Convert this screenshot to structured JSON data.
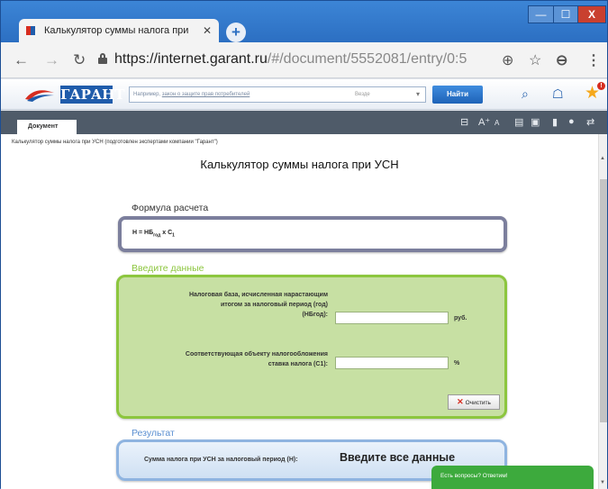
{
  "browser": {
    "tab_title": "Калькулятор суммы налога при",
    "tab_close": "✕",
    "new_tab": "+",
    "url_host": "https://internet.garant.ru",
    "url_path": "/#/document/5552081/entry/0:5",
    "window_controls": {
      "minimize": "—",
      "maximize": "☐",
      "close": "X"
    }
  },
  "garant": {
    "logo": "ГАРАНТ",
    "search_placeholder": "Например,",
    "search_example": "закон о защите прав потребителей",
    "search_scope": "Везде",
    "find_button": "Найти",
    "notification_count": "!"
  },
  "doc_tab": "Документ",
  "document": {
    "breadcrumb": "Калькулятор суммы налога при УСН (подготовлен экспертами компании \"Гарант\")",
    "title": "Калькулятор суммы налога при УСН"
  },
  "formula": {
    "heading": "Формула расчета",
    "expression_main": "Н = НБ",
    "expression_sub": "год",
    "expression_tail": " x С",
    "expression_tail_sub": "1"
  },
  "input_section": {
    "heading": "Введите данные",
    "field1_label_lines": [
      "Налоговая база, исчисленная нарастающим",
      "итогом за налоговый период (год)",
      "(НБгод):"
    ],
    "field1_value": "",
    "field1_unit": "руб.",
    "field2_label_lines": [
      "Соответствующая объекту налогообложения",
      "ставка налога (С1):"
    ],
    "field2_value": "",
    "field2_unit": "%",
    "clear_button": "Очистить"
  },
  "result": {
    "heading": "Результат",
    "label": "Сумма налога при УСН за налоговый период (Н):",
    "value": "Введите все данные"
  },
  "chat": {
    "label": "Есть вопросы? Ответим!"
  },
  "colors": {
    "formula_border": "#7c7f9d",
    "input_border": "#8cc63e",
    "input_fill": "#c7e0a3",
    "result_border": "#8fb4e0",
    "input_heading": "#8cc63e",
    "result_heading": "#5b8fd1",
    "chat": "#3daa3d"
  }
}
